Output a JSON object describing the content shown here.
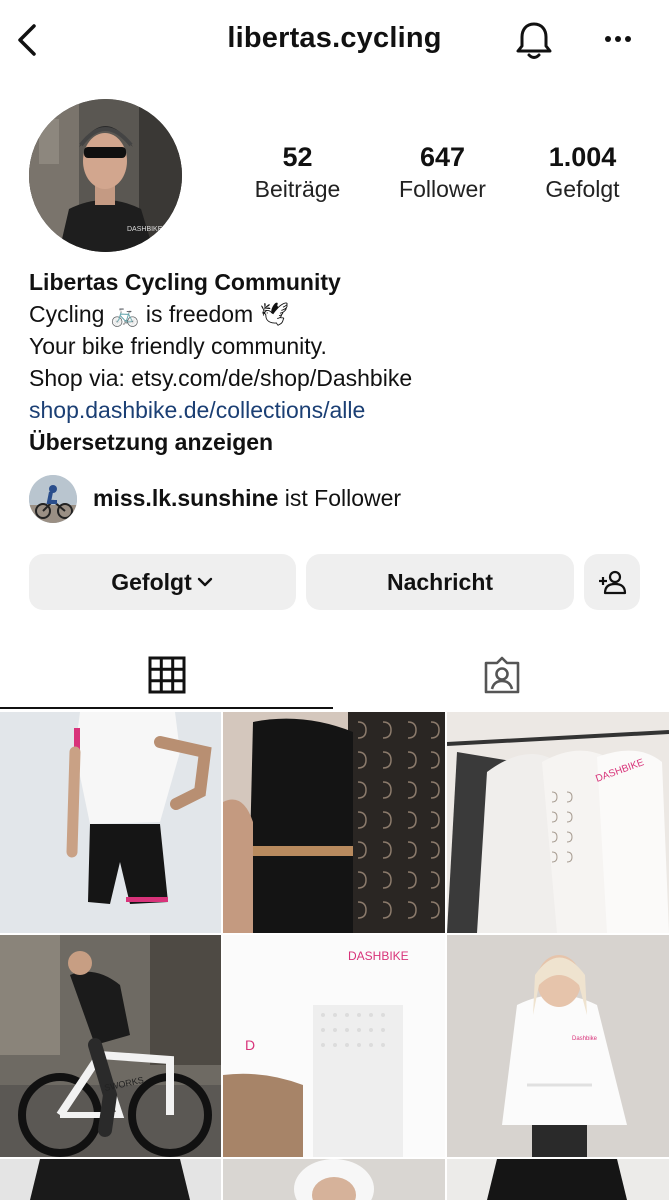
{
  "header": {
    "username": "libertas.cycling",
    "back_icon": "chevron-left-icon",
    "notifications_icon": "bell-icon",
    "more_icon": "more-dots-icon"
  },
  "profile": {
    "avatar_brand": "DASHBIKE",
    "stats": [
      {
        "value": "52",
        "label": "Beiträge"
      },
      {
        "value": "647",
        "label": "Follower"
      },
      {
        "value": "1.004",
        "label": "Gefolgt"
      }
    ]
  },
  "bio": {
    "name": "Libertas Cycling Community",
    "line1_a": "Cycling ",
    "line1_emoji1": "🚲",
    "line1_b": " is freedom ",
    "line1_emoji2": "🕊",
    "line2": "Your bike friendly community.",
    "line3": "Shop via: etsy.com/de/shop/Dashbike",
    "link": "shop.dashbike.de/collections/alle",
    "translate": "Übersetzung anzeigen"
  },
  "mutual": {
    "username": "miss.lk.sunshine",
    "suffix": " ist Follower"
  },
  "actions": {
    "following": "Gefolgt",
    "message": "Nachricht",
    "add_user_icon": "person-plus-icon"
  },
  "tabs": {
    "grid_icon": "grid-icon",
    "tagged_icon": "tagged-person-icon",
    "active": "grid"
  },
  "posts": [
    {
      "brand": ""
    },
    {
      "brand": ""
    },
    {
      "brand": "DASHBIKE"
    },
    {
      "brand": "SWORKS"
    },
    {
      "brand": "DASHBIKE"
    },
    {
      "brand": "Dashbike"
    }
  ],
  "colors": {
    "link": "#1b3f74",
    "button_bg": "#efefef",
    "accent_pink": "#d8337a"
  }
}
